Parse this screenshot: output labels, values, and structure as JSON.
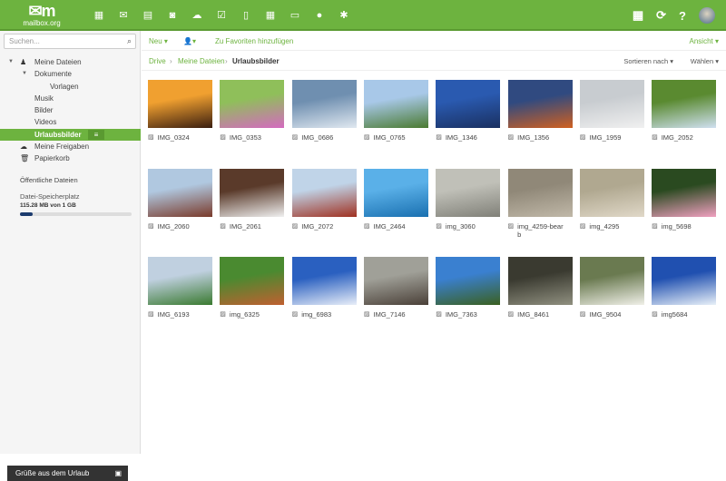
{
  "header": {
    "logo_text": "mailbox.org",
    "apps": [
      "portal",
      "mail",
      "calendar",
      "contacts",
      "drive",
      "tasks",
      "documents",
      "spreadsheets",
      "presentations",
      "chat",
      "settings"
    ]
  },
  "search": {
    "placeholder": "Suchen..."
  },
  "tree": [
    {
      "label": "Meine Dateien",
      "level": 0
    },
    {
      "label": "Dokumente",
      "level": 1
    },
    {
      "label": "Vorlagen",
      "level": 2
    },
    {
      "label": "Musik",
      "level": 1
    },
    {
      "label": "Bilder",
      "level": 1
    },
    {
      "label": "Videos",
      "level": 1
    },
    {
      "label": "Urlaubsbilder",
      "level": 1,
      "selected": true
    },
    {
      "label": "Meine Freigaben",
      "level": 0
    },
    {
      "label": "Papierkorb",
      "level": 0
    }
  ],
  "public_files": "Öffentliche Dateien",
  "storage": {
    "label": "Datei-Speicherplatz",
    "value": "115.28 MB von 1 GB",
    "fraction": 0.113
  },
  "greeting": "Grüße aus dem Urlaub",
  "toolbar": {
    "new": "Neu ▾",
    "share": "▾",
    "favorite": "Zu Favoriten hinzufügen",
    "view": "Ansicht ▾"
  },
  "breadcrumb": {
    "drive": "Drive",
    "my_files": "Meine Dateien",
    "current": "Urlaubsbilder",
    "sort": "Sortieren nach ▾",
    "select": "Wählen ▾"
  },
  "files": [
    {
      "name": "IMG_0324",
      "colors": [
        "#f0a030",
        "#3a1e10"
      ]
    },
    {
      "name": "IMG_0353",
      "colors": [
        "#8fbf5a",
        "#d46ac0"
      ]
    },
    {
      "name": "IMG_0686",
      "colors": [
        "#6f8fb0",
        "#e0e8f0"
      ]
    },
    {
      "name": "IMG_0765",
      "colors": [
        "#a8c8e8",
        "#4a7a30"
      ]
    },
    {
      "name": "IMG_1346",
      "colors": [
        "#2a5ab0",
        "#1a3060"
      ]
    },
    {
      "name": "IMG_1356",
      "colors": [
        "#304a80",
        "#d06020"
      ]
    },
    {
      "name": "IMG_1959",
      "colors": [
        "#c8ccd0",
        "#f0f0f0"
      ]
    },
    {
      "name": "IMG_2052",
      "colors": [
        "#5a8a30",
        "#d0e0f0"
      ]
    },
    {
      "name": "IMG_2060",
      "colors": [
        "#b0c8e0",
        "#7a3a2a"
      ]
    },
    {
      "name": "IMG_2061",
      "colors": [
        "#5a3a2a",
        "#f0f0f0"
      ]
    },
    {
      "name": "IMG_2072",
      "colors": [
        "#c0d4e8",
        "#a03020"
      ]
    },
    {
      "name": "IMG_2464",
      "colors": [
        "#5ab0e8",
        "#1a70b0"
      ]
    },
    {
      "name": "img_3060",
      "colors": [
        "#c0c0b8",
        "#808078"
      ]
    },
    {
      "name": "img_4259-bearb",
      "colors": [
        "#908878",
        "#c0b8a8"
      ]
    },
    {
      "name": "img_4295",
      "colors": [
        "#b0a890",
        "#e0d8c8"
      ]
    },
    {
      "name": "img_5698",
      "colors": [
        "#2a4a20",
        "#f0a0c0"
      ]
    },
    {
      "name": "IMG_6193",
      "colors": [
        "#c0d0e0",
        "#3a7a30"
      ]
    },
    {
      "name": "img_6325",
      "colors": [
        "#4a8a30",
        "#c06030"
      ]
    },
    {
      "name": "img_6983",
      "colors": [
        "#2a60c0",
        "#e8eef8"
      ]
    },
    {
      "name": "IMG_7146",
      "colors": [
        "#a0a098",
        "#4a4038"
      ]
    },
    {
      "name": "IMG_7363",
      "colors": [
        "#3a80d0",
        "#3a6020"
      ]
    },
    {
      "name": "IMG_8461",
      "colors": [
        "#3a3a30",
        "#909080"
      ]
    },
    {
      "name": "IMG_9504",
      "colors": [
        "#6a7a50",
        "#f0f0e8"
      ]
    },
    {
      "name": "img5684",
      "colors": [
        "#2050b0",
        "#e8f0f8"
      ]
    }
  ]
}
